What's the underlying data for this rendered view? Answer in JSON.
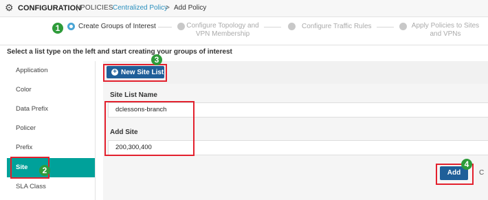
{
  "header": {
    "title": "CONFIGURATION",
    "separator": "|",
    "section": "POLICIES",
    "breadcrumb_link": "Centralized Policy",
    "breadcrumb_arrow": ">",
    "current": "Add Policy"
  },
  "steps": [
    {
      "label": "Create Groups of Interest",
      "active": true
    },
    {
      "label": "Configure Topology and VPN Membership",
      "active": false
    },
    {
      "label": "Configure Traffic Rules",
      "active": false
    },
    {
      "label": "Apply Policies to Sites and VPNs",
      "active": false
    }
  ],
  "step2_lines": [
    "Configure Topology and",
    "VPN Membership"
  ],
  "step4_lines": [
    "Apply Policies to Sites",
    "and VPNs"
  ],
  "instruction": "Select a list type on the left and start creating your groups of interest",
  "list_types": [
    "Application",
    "Color",
    "Data Prefix",
    "Policer",
    "Prefix",
    "Site",
    "SLA Class"
  ],
  "selected_list_type": "Site",
  "new_button_label": "New Site List",
  "form": {
    "site_list_name_label": "Site List Name",
    "site_list_name_value": "dclessons-branch",
    "add_site_label": "Add Site",
    "add_site_value": "200,300,400"
  },
  "add_button_label": "Add",
  "cancel_peek": "C",
  "annotations": [
    "1",
    "2",
    "3",
    "4"
  ],
  "colors": {
    "accent": "#00a19a",
    "primary": "#1f5f99",
    "link": "#2a8fbd",
    "annotation_red": "#e3202d",
    "annotation_green": "#2e9b3a"
  }
}
